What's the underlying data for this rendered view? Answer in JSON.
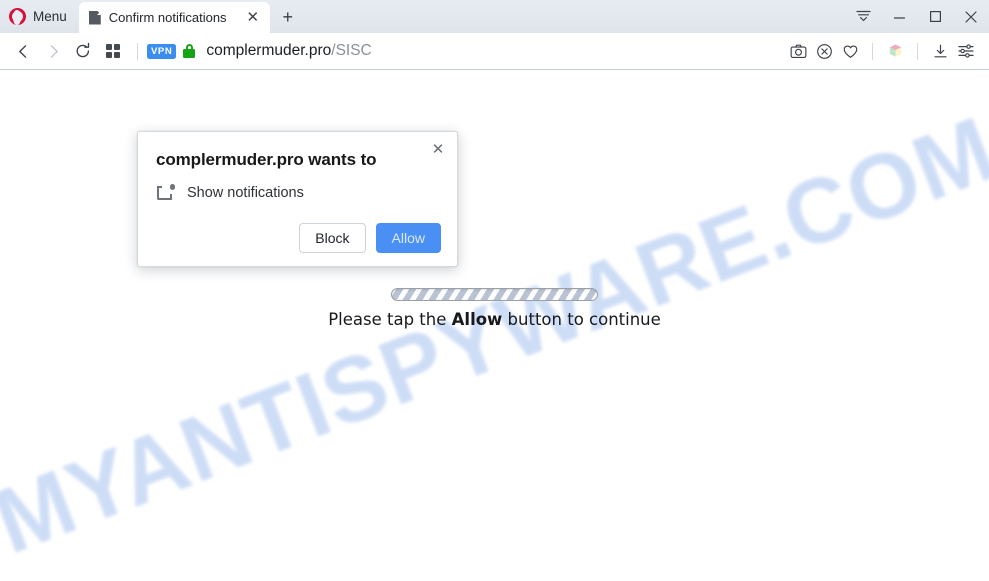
{
  "window": {
    "menu_label": "Menu",
    "controls": {
      "tab_list": "tab-list",
      "minimize": "minimize",
      "maximize": "maximize",
      "close": "close"
    }
  },
  "tabs": [
    {
      "title": "Confirm notifications",
      "favicon": "page-icon",
      "close_label": "✕"
    }
  ],
  "newtab_label": "+",
  "toolbar": {
    "back": "‹",
    "forward": "›",
    "reload": "reload-icon",
    "grid": "speed-dial-icon",
    "vpn_badge": "VPN",
    "lock": "secure-lock-icon",
    "url_host": "complermuder.pro",
    "url_path": "/SISC",
    "right_icons": [
      "snapshot-icon",
      "ad-blocker-icon",
      "heart-icon",
      "workspace-cube-icon",
      "download-icon",
      "easy-setup-icon"
    ]
  },
  "dialog": {
    "title": "complermuder.pro wants to",
    "permission": "Show notifications",
    "permission_icon": "notification-icon",
    "close_label": "✕",
    "block_label": "Block",
    "allow_label": "Allow",
    "allow_color": "#4a90f4"
  },
  "page": {
    "watermark": "MYANTISPYWARE.COM",
    "watermark_color": "#ccdcf6",
    "progress_label": "loading-progress-bar",
    "instruction_prefix": "Please tap the ",
    "instruction_bold": "Allow",
    "instruction_suffix": " button to continue"
  }
}
